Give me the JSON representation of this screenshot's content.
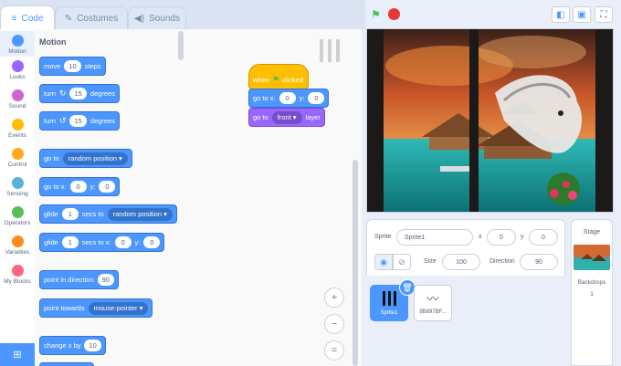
{
  "tabs": {
    "code": "Code",
    "costumes": "Costumes",
    "sounds": "Sounds"
  },
  "categories": [
    {
      "label": "Motion",
      "color": "#4c97ff"
    },
    {
      "label": "Looks",
      "color": "#9966ff"
    },
    {
      "label": "Sound",
      "color": "#cf63cf"
    },
    {
      "label": "Events",
      "color": "#ffbf00"
    },
    {
      "label": "Control",
      "color": "#ffab19"
    },
    {
      "label": "Sensing",
      "color": "#5cb1d6"
    },
    {
      "label": "Operators",
      "color": "#59c059"
    },
    {
      "label": "Variables",
      "color": "#ff8c1a"
    },
    {
      "label": "My Blocks",
      "color": "#ff6680"
    }
  ],
  "palette": {
    "title": "Motion",
    "move": {
      "pre": "move",
      "val": "10",
      "post": "steps"
    },
    "turn_right": {
      "pre": "turn",
      "val": "15",
      "post": "degrees"
    },
    "turn_left": {
      "pre": "turn",
      "val": "15",
      "post": "degrees"
    },
    "goto": {
      "pre": "go to",
      "drop": "random position"
    },
    "goto_xy": {
      "pre": "go to x:",
      "x": "0",
      "ylabel": "y:",
      "y": "0"
    },
    "glide": {
      "pre": "glide",
      "val": "1",
      "mid": "secs to",
      "drop": "random position"
    },
    "glide_xy": {
      "pre": "glide",
      "val": "1",
      "mid": "secs to x:",
      "x": "0",
      "ylabel": "y:",
      "y": "0"
    },
    "point_dir": {
      "pre": "point in direction",
      "val": "90"
    },
    "point_towards": {
      "pre": "point towards",
      "drop": "mouse-pointer"
    },
    "change_x": {
      "pre": "change x by",
      "val": "10"
    }
  },
  "script": {
    "when": "when",
    "clicked": "clicked",
    "goto_xy": {
      "pre": "go to x:",
      "x": "0",
      "ylabel": "y:",
      "y": "0"
    },
    "goto_layer": {
      "pre": "go to",
      "drop": "front",
      "post": "layer"
    }
  },
  "zoom": {
    "in": "+",
    "out": "−",
    "reset": "="
  },
  "sprite_info": {
    "sprite_label": "Sprite",
    "sprite_name": "Sprite1",
    "x_label": "x",
    "x": "0",
    "y_label": "y",
    "y": "0",
    "size_label": "Size",
    "size": "100",
    "direction_label": "Direction",
    "direction": "90"
  },
  "sprites": [
    {
      "name": "Sprite1",
      "selected": true
    },
    {
      "name": "9B897BF...",
      "selected": false
    }
  ],
  "stage_panel": {
    "title": "Stage",
    "backdrops_label": "Backdrops",
    "backdrops_count": "1"
  },
  "colors": {
    "motion": "#4c97ff",
    "events": "#ffbf00",
    "looks": "#9966ff",
    "accent": "#4c97ff"
  }
}
